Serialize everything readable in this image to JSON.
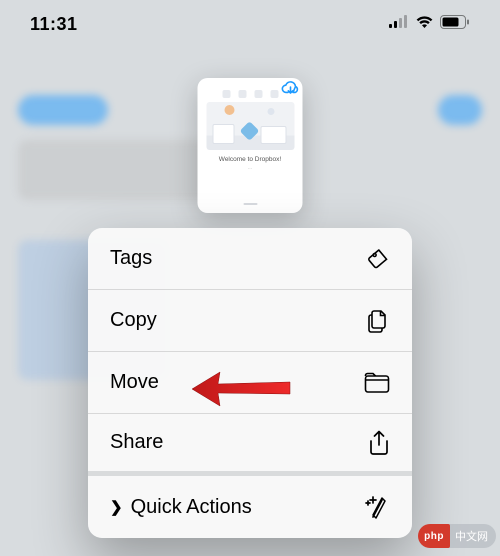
{
  "status_bar": {
    "time": "11:31"
  },
  "preview": {
    "caption": "Welcome to Dropbox!",
    "subcaption": "···"
  },
  "menu": {
    "items": [
      {
        "label": "Tags",
        "icon": "tag-icon"
      },
      {
        "label": "Copy",
        "icon": "copy-icon"
      },
      {
        "label": "Move",
        "icon": "folder-icon"
      },
      {
        "label": "Share",
        "icon": "share-icon"
      },
      {
        "label": "Quick Actions",
        "icon": "sparkle-icon",
        "has_chevron": true
      }
    ]
  },
  "watermark": {
    "badge": "php",
    "text": "中文网"
  }
}
